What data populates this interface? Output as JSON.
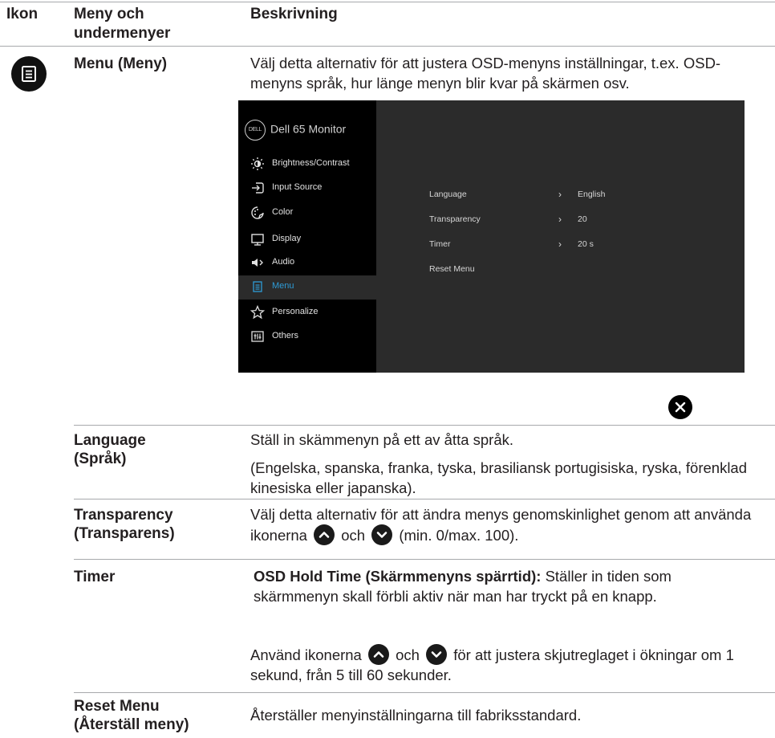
{
  "header": {
    "col_icon": "Ikon",
    "col_menu": "Meny och\nundermenyer",
    "col_desc": "Beskrivning"
  },
  "menu_row": {
    "label": "Menu (Meny)",
    "description": "Välj detta alternativ för att justera OSD-menyns inställningar, t.ex. OSD-menyns språk, hur länge menyn blir kvar på skärmen osv.",
    "icon": "menu-list-icon"
  },
  "osd": {
    "brand": "Dell 65 Monitor",
    "logo_text": "DELL",
    "items": [
      {
        "label": "Brightness/Contrast",
        "icon": "brightness-icon"
      },
      {
        "label": "Input Source",
        "icon": "input-source-icon"
      },
      {
        "label": "Color",
        "icon": "color-icon"
      },
      {
        "label": "Display",
        "icon": "display-icon"
      },
      {
        "label": "Audio",
        "icon": "audio-icon"
      },
      {
        "label": "Menu",
        "icon": "menu-icon"
      },
      {
        "label": "Personalize",
        "icon": "star-icon"
      },
      {
        "label": "Others",
        "icon": "others-icon"
      }
    ],
    "active_item": "Menu",
    "settings": [
      {
        "label": "Language",
        "value": "English"
      },
      {
        "label": "Transparency",
        "value": "20"
      },
      {
        "label": "Timer",
        "value": "20 s"
      },
      {
        "label": "Reset Menu",
        "value": ""
      }
    ],
    "accent_color": "#2e9bd6"
  },
  "rows": {
    "language": {
      "label": "Language\n(Språk)",
      "line1": "Ställ in skämmenyn på ett av åtta språk.",
      "line2": "(Engelska, spanska, franka, tyska, brasiliansk portugisiska, ryska, förenklad kinesiska eller japanska)."
    },
    "transparency": {
      "label": "Transparency\n(Transparens)",
      "text_a": "Välj detta alternativ för att ändra menys genomskinlighet genom att använda ikonerna",
      "text_b": "och",
      "text_c": "(min. 0/max. 100)."
    },
    "timer": {
      "label": "Timer",
      "bold": "OSD Hold Time (Skärmmenyns spärrtid):",
      "text": "Ställer in tiden som skärmmenyn skall förbli aktiv när man har tryckt på en knapp.",
      "p2_a": "Använd ikonerna",
      "p2_b": "och",
      "p2_c": "för att justera skjutreglaget i ökningar om 1 sekund, från 5 till 60 sekunder."
    },
    "reset": {
      "label": "Reset Menu\n(Återställ meny)",
      "text": "Återställer menyinställningarna till fabriksstandard."
    }
  }
}
